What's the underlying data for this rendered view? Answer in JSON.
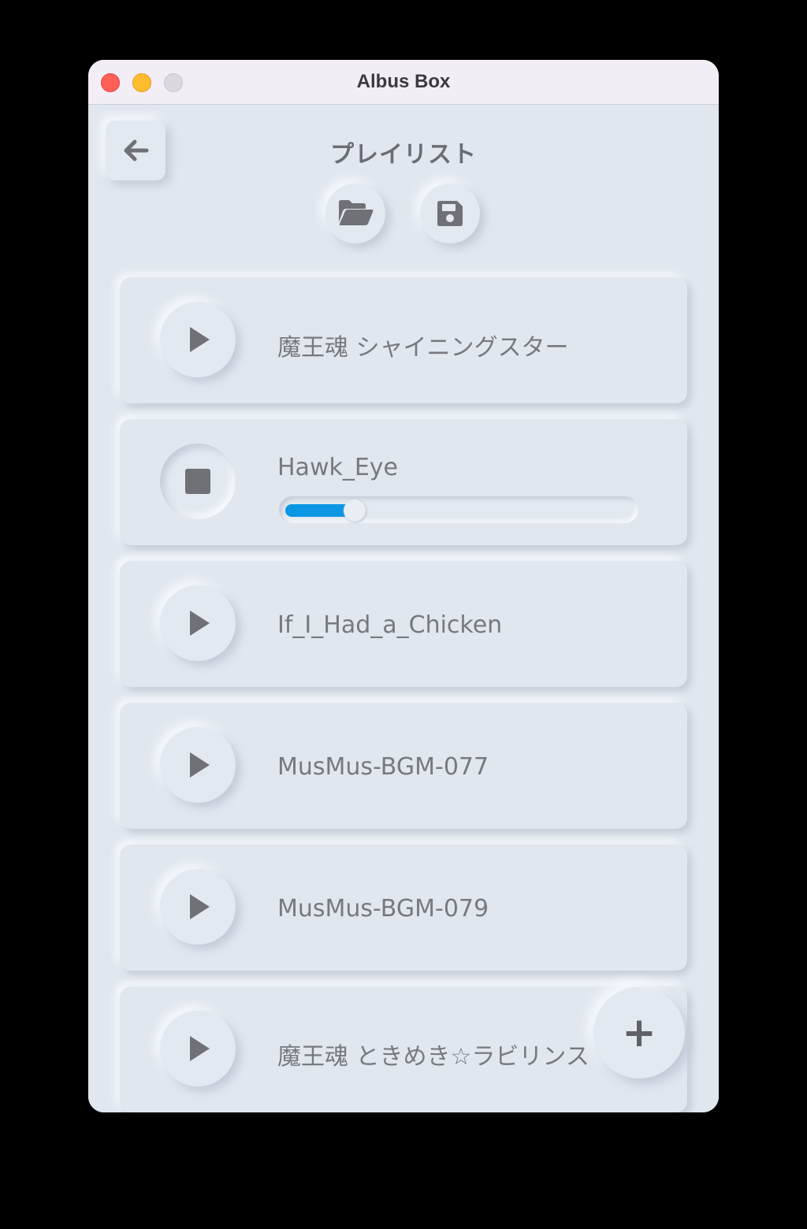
{
  "window": {
    "title": "Albus Box"
  },
  "header": {
    "title": "プレイリスト",
    "back_icon": "arrow-left-icon",
    "open_icon": "folder-open-icon",
    "save_icon": "floppy-disk-icon"
  },
  "playlist": {
    "tracks": [
      {
        "name": "魔王魂 シャイニングスター",
        "state": "stopped",
        "icon": "play-icon"
      },
      {
        "name": "Hawk_Eye",
        "state": "playing",
        "icon": "stop-icon",
        "progress": 0.2
      },
      {
        "name": "If_I_Had_a_Chicken",
        "state": "stopped",
        "icon": "play-icon"
      },
      {
        "name": "MusMus-BGM-077",
        "state": "stopped",
        "icon": "play-icon"
      },
      {
        "name": "MusMus-BGM-079",
        "state": "stopped",
        "icon": "play-icon"
      },
      {
        "name": "魔王魂 ときめき☆ラビリンス",
        "state": "stopped",
        "icon": "play-icon"
      }
    ]
  },
  "fab": {
    "label": "+",
    "icon": "plus-icon"
  },
  "colors": {
    "background": "#e1e7ef",
    "accent": "#0b97e3",
    "icon": "#6f7176"
  }
}
